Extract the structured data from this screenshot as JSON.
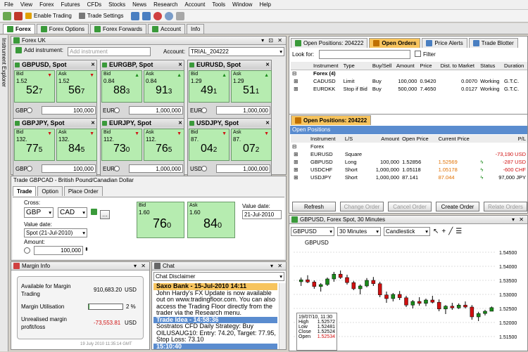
{
  "menu": [
    "File",
    "View",
    "Forex",
    "Futures",
    "CFDs",
    "Stocks",
    "News",
    "Research",
    "Account",
    "Tools",
    "Window",
    "Help"
  ],
  "toolbar": {
    "enable_trading": "Enable Trading",
    "trade_settings": "Trade Settings"
  },
  "ws_tabs": [
    "Forex",
    "Forex Options",
    "Forex Forwards",
    "Account",
    "Info"
  ],
  "side_tab": "Instrument Explorer",
  "forex_panel": {
    "title": "Forex UK",
    "add_label": "Add instrument:",
    "add_placeholder": "Add instrument",
    "account_label": "Account:",
    "account_value": "TRIAL_204222",
    "tiles": [
      {
        "name": "GBPUSD, Spot",
        "bid_pre": "1.52",
        "bid_big": "52",
        "bid_sub": "7",
        "ask_pre": "1.52",
        "ask_big": "56",
        "ask_sub": "7",
        "ccy": "GBP",
        "amount": "100,000",
        "bid_arrow": "▼",
        "ask_arrow": "▼"
      },
      {
        "name": "EURGBP, Spot",
        "bid_pre": "0.84",
        "bid_big": "88",
        "bid_sub": "3",
        "ask_pre": "0.84",
        "ask_big": "91",
        "ask_sub": "3",
        "ccy": "EUR",
        "amount": "1,000,000",
        "bid_arrow": "▲",
        "ask_arrow": "▲"
      },
      {
        "name": "EURUSD, Spot",
        "bid_pre": "1.29",
        "bid_big": "49",
        "bid_sub": "1",
        "ask_pre": "1.29",
        "ask_big": "51",
        "ask_sub": "1",
        "ccy": "EUR",
        "amount": "1,000,000",
        "bid_arrow": "▲",
        "ask_arrow": "▲"
      },
      {
        "name": "GBPJPY, Spot",
        "bid_pre": "132.",
        "bid_big": "77",
        "bid_sub": "5",
        "ask_pre": "132.",
        "ask_big": "84",
        "ask_sub": "5",
        "ccy": "GBP",
        "amount": "100,000",
        "bid_arrow": "▼",
        "ask_arrow": "▼"
      },
      {
        "name": "EURJPY, Spot",
        "bid_pre": "112.",
        "bid_big": "73",
        "bid_sub": "0",
        "ask_pre": "112.",
        "ask_big": "76",
        "ask_sub": "5",
        "ccy": "EUR",
        "amount": "1,000,000",
        "bid_arrow": "▼",
        "ask_arrow": "▼"
      },
      {
        "name": "USDJPY, Spot",
        "bid_pre": "87.",
        "bid_big": "04",
        "bid_sub": "2",
        "ask_pre": "87.",
        "ask_big": "07",
        "ask_sub": "2",
        "ccy": "USD",
        "amount": "1,000,000",
        "bid_arrow": "▼",
        "ask_arrow": "▼"
      }
    ]
  },
  "trade": {
    "title": "Trade GBPCAD - British Pound/Canadian Dollar",
    "tabs": [
      "Trade",
      "Option",
      "Place Order"
    ],
    "cross_label": "Cross:",
    "ccy1": "GBP",
    "ccy2": "CAD",
    "value_date_label": "Value date:",
    "value_date": "Spot (21-Jul-2010)",
    "amount_label": "Amount:",
    "amount": "100,000",
    "bid_label": "Bid",
    "bid_pre": "1.60",
    "bid_big": "76",
    "bid_sub": "0",
    "ask_label": "Ask",
    "ask_pre": "1.60",
    "ask_big": "84",
    "ask_sub": "0",
    "vd2_label": "Value date:",
    "vd2": "21-Jul-2010"
  },
  "margin": {
    "title": "Margin Info",
    "available_label": "Available for Margin Trading",
    "available_value": "910,683.20",
    "ccy": "USD",
    "utilisation_label": "Margin Utilisation",
    "utilisation_pct": "2 %",
    "utilisation_fraction": 0.02,
    "unrealised_label": "Unrealised margin profit/loss",
    "unrealised_value": "-73,553.81",
    "timestamp": "19 July 2010 11:35:14 GMT"
  },
  "chat": {
    "title": "Chat",
    "disclaimer": "Chat Disclaimer",
    "msg1_head": "Saxo Bank - 15-Jul-2010 14:11",
    "msg1_body": "John Hardy's FX Update is now available out on www.tradingfloor.com. You can also access the Trading Floor directly from the trader via the Research menu.",
    "msg2_head": "Trade Idea - 14:58:36",
    "msg2_body": "Sostratos CFD Daily Strategy: Buy OILUSAUG10: Entry: 74.20, Target: 77.95, Stop Loss: 73.10",
    "msg3_head": "15:10:40"
  },
  "orders": {
    "tabs": [
      "Open Positions: 204222",
      "Open Orders",
      "Price Alerts",
      "Trade Blotter"
    ],
    "look_for": "Look for:",
    "filter": "Filter",
    "headers": [
      "Instrument",
      "Type",
      "Buy/Sell",
      "Amount",
      "Price",
      "Dist. to Market",
      "Status",
      "Duration"
    ],
    "group": "Forex (4)",
    "rows": [
      {
        "inst": "CADUSD",
        "type": "Limit",
        "bs": "Buy",
        "amount": "100,000",
        "price": "0.9420",
        "dist": "0.0070",
        "status": "Working",
        "dur": "G.T.C."
      },
      {
        "inst": "EURDKK",
        "type": "Stop if Bid",
        "bs": "Buy",
        "amount": "500,000",
        "price": "7.4650",
        "dist": "0.0127",
        "status": "Working",
        "dur": "G.T.C."
      }
    ]
  },
  "positions": {
    "tab": "Open Positions: 204222",
    "title": "Open Positions",
    "headers": [
      "Instrument",
      "L/S",
      "Amount",
      "Open Price",
      "Current Price",
      "P/L"
    ],
    "group": "Forex",
    "rows": [
      {
        "inst": "EURUSD",
        "ls": "Square",
        "amount": "",
        "open": "",
        "current": "",
        "pl": "-73,190 USD"
      },
      {
        "inst": "GBPUSD",
        "ls": "Long",
        "amount": "100,000",
        "open": "1.52856",
        "current": "1.52569",
        "pl": "-287 USD"
      },
      {
        "inst": "USDCHF",
        "ls": "Short",
        "amount": "1,000,000",
        "open": "1.05118",
        "current": "1.05178",
        "pl": "-600 CHF"
      },
      {
        "inst": "USDJPY",
        "ls": "Short",
        "amount": "1,000,000",
        "open": "87.141",
        "current": "87.044",
        "pl": "97,000 JPY"
      }
    ],
    "buttons": [
      "Refresh",
      "Change Order",
      "Cancel Order",
      "Create Order",
      "Relate Orders"
    ]
  },
  "chart": {
    "title": "GBPUSD, Forex Spot, 30 Minutes",
    "symbol": "GBPUSD",
    "interval": "30 Minutes",
    "style": "Candlestick",
    "label": "GBPUSD",
    "y_ticks": [
      "1.54500",
      "1.54000",
      "1.53500",
      "1.53000",
      "1.52500",
      "1.52000",
      "1.51500"
    ],
    "tooltip": {
      "date": "19/07/10, 11:30",
      "high_l": "High",
      "high": "1.52572",
      "low_l": "Low",
      "low": "1.52481",
      "close_l": "Close",
      "close": "1.52524",
      "open_l": "Open",
      "open": "1.52534"
    }
  },
  "chart_data": {
    "type": "candlestick",
    "ylim": [
      1.51,
      1.55
    ],
    "candles": [
      [
        1.5345,
        1.536,
        1.533,
        1.5352
      ],
      [
        1.5352,
        1.5368,
        1.534,
        1.5344
      ],
      [
        1.5344,
        1.535,
        1.532,
        1.5328
      ],
      [
        1.5328,
        1.534,
        1.531,
        1.5335
      ],
      [
        1.5335,
        1.536,
        1.533,
        1.5355
      ],
      [
        1.5355,
        1.538,
        1.5345,
        1.5372
      ],
      [
        1.5372,
        1.5385,
        1.5355,
        1.536
      ],
      [
        1.536,
        1.537,
        1.5335,
        1.5342
      ],
      [
        1.5342,
        1.5348,
        1.5315,
        1.532
      ],
      [
        1.532,
        1.5335,
        1.53,
        1.533
      ],
      [
        1.533,
        1.5358,
        1.5325,
        1.535
      ],
      [
        1.535,
        1.5362,
        1.533,
        1.5338
      ],
      [
        1.5338,
        1.5345,
        1.529,
        1.5298
      ],
      [
        1.5298,
        1.531,
        1.527,
        1.5285
      ],
      [
        1.5285,
        1.5305,
        1.5275,
        1.53
      ],
      [
        1.53,
        1.5312,
        1.528,
        1.5288
      ],
      [
        1.5288,
        1.5295,
        1.5255,
        1.5262
      ],
      [
        1.5262,
        1.528,
        1.525,
        1.5275
      ],
      [
        1.5275,
        1.529,
        1.526,
        1.5268
      ],
      [
        1.5268,
        1.5285,
        1.5258,
        1.528
      ],
      [
        1.528,
        1.5295,
        1.5268,
        1.5272
      ],
      [
        1.5272,
        1.5282,
        1.524,
        1.5248
      ],
      [
        1.5248,
        1.5262,
        1.523,
        1.5258
      ],
      [
        1.5258,
        1.527,
        1.5245,
        1.5252
      ],
      [
        1.5252,
        1.5268,
        1.5248,
        1.5262
      ],
      [
        1.5262,
        1.5275,
        1.525,
        1.5255
      ],
      [
        1.5255,
        1.5262,
        1.521,
        1.522
      ],
      [
        1.522,
        1.5238,
        1.5205,
        1.5232
      ],
      [
        1.5232,
        1.5245,
        1.5225,
        1.524
      ],
      [
        1.524,
        1.5257,
        1.5248,
        1.5253
      ]
    ]
  },
  "colors": {
    "tile_green": "#b6ecb0",
    "header_orange": "#f7c45e",
    "chat_blue": "#5a8ccf"
  }
}
